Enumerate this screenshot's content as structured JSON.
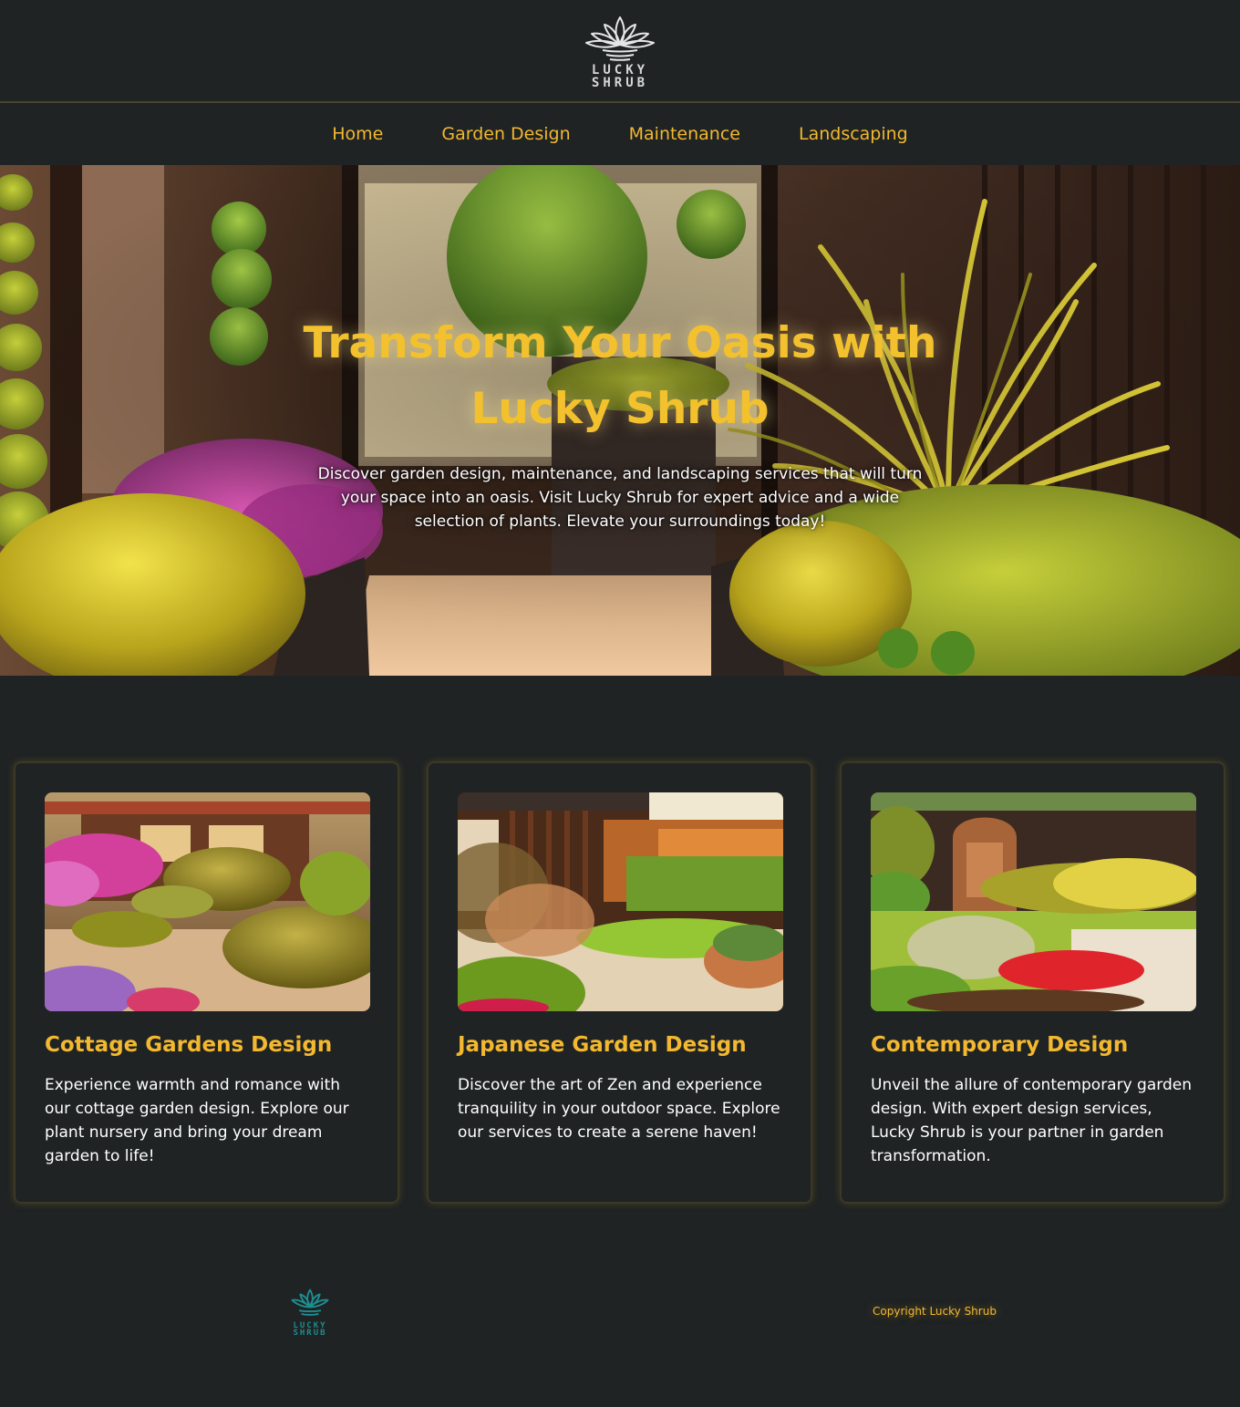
{
  "brand": {
    "logo_line1": "LUCKY",
    "logo_line2": "SHRUB"
  },
  "nav": {
    "items": [
      {
        "label": "Home"
      },
      {
        "label": "Garden Design"
      },
      {
        "label": "Maintenance"
      },
      {
        "label": "Landscaping"
      }
    ]
  },
  "hero": {
    "title": "Transform Your Oasis with Lucky Shrub",
    "text": "Discover garden design, maintenance, and landscaping services that will turn your space into an oasis. Visit Lucky Shrub for expert advice and a wide selection of plants. Elevate your surroundings today!"
  },
  "cards": [
    {
      "title": "Cottage Gardens Design",
      "text": "Experience warmth and romance with our cottage garden design. Explore our plant nursery and bring your dream garden to life!"
    },
    {
      "title": "Japanese Garden Design",
      "text": "Discover the art of Zen and experience tranquility in your outdoor space. Explore our services to create a serene haven!"
    },
    {
      "title": "Contemporary Design",
      "text": "Unveil the allure of contemporary garden design. With expert design services, Lucky Shrub is your partner in garden transformation."
    }
  ],
  "footer": {
    "logo_line1": "LUCKY",
    "logo_line2": "SHRUB",
    "copyright": "Copyright Lucky Shrub"
  },
  "colors": {
    "background": "#1f2324",
    "accent": "#f3b82f",
    "hero_title": "#f2c12d",
    "footer_logo": "#1e8d8f"
  },
  "icons": {
    "header_logo": "lotus-logo-icon",
    "footer_logo": "lotus-logo-icon"
  }
}
